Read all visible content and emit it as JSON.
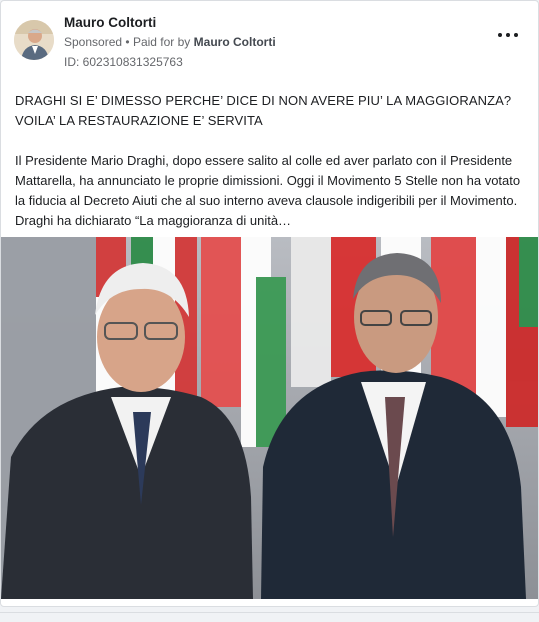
{
  "post": {
    "author": "Mauro Coltorti",
    "sponsored_label": "Sponsored",
    "separator": "•",
    "paid_for_label": "Paid for by",
    "paid_for_name": "Mauro Coltorti",
    "ad_id": "ID: 602310831325763",
    "headline_line1": "DRAGHI SI E’ DIMESSO PERCHE’ DICE DI NON AVERE PIU’ LA MAGGIORANZA?",
    "headline_line2": "VOILA’ LA RESTAURAZIONE E’ SERVITA",
    "body": "Il Presidente Mario Draghi, dopo essere salito al colle ed aver parlato con il Presidente Mattarella, ha annunciato le proprie dimissioni. Oggi il Movimento 5 Stelle non ha votato la fiducia al Decreto Aiuti che al suo interno aveva clausole indigeribili per il Movimento. Draghi ha dichiarato “La maggioranza di unità…",
    "more_icon": "more-horizontal-icon",
    "image_description_icon": "photo"
  },
  "colors": {
    "background": "#f0f2f5",
    "card": "#ffffff",
    "text": "#1c1e21",
    "secondary_text": "#65676b"
  }
}
